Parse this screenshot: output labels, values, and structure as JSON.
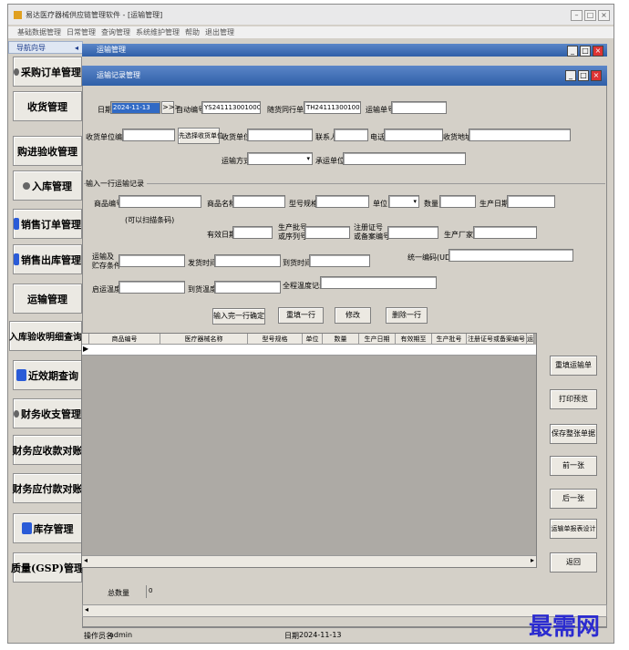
{
  "window": {
    "title": "易达医疗器械供应链管理软件 - [运输管理]"
  },
  "menu": [
    "基础数据管理",
    "日常管理",
    "查询管理",
    "系统维护管理",
    "帮助",
    "退出管理"
  ],
  "nav": {
    "header": "导航向导",
    "items": [
      "采购订单管理",
      "收货管理",
      "购进验收管理",
      "入库管理",
      "销售订单管理",
      "销售出库管理",
      "运输管理",
      "入库验收明细查询",
      "近效期查询",
      "财务收支管理",
      "财务应收款对账",
      "财务应付款对账",
      "库存管理",
      "质量(GSP)管理"
    ]
  },
  "outer_tab": "运输管理",
  "inner_title": "运输记录管理",
  "form": {
    "date_label": "日期",
    "date_value": "2024-11-13",
    "date_btn": ">>>",
    "auto_label": "自动编号",
    "auto_value": "YS2411130010001",
    "seq_label": "随货同行单号",
    "seq_value": "TH2411130010001",
    "ship_label": "运输单号",
    "recv_code_label": "收货单位编号",
    "pick_btn": "先选择收货单位",
    "recv_unit_label": "收货单位",
    "contact_label": "联系人",
    "phone_label": "电话",
    "addr_label": "收货地址",
    "method_label": "运输方式",
    "carrier_label": "承运单位"
  },
  "section": {
    "title": "输入一行运输记录",
    "code_label": "商品编号",
    "code_hint": "(可以扫描条码)",
    "name_label": "商品名称",
    "model_label": "型号规格",
    "unit_label": "单位",
    "qty_label": "数量",
    "prod_date_label": "生产日期",
    "expiry_label": "有效日期",
    "batch_label": "生产批号\n或序列号",
    "reg_label": "注册证号\n或备案编号",
    "maker_label": "生产厂家",
    "cond_label": "运输及\n贮存条件",
    "depart_label": "发货时间",
    "arrive_label": "到货时间",
    "udi_label": "统一编码(UDI)",
    "start_temp_label": "启运温度",
    "arrive_temp_label": "到货温度",
    "full_temp_label": "全程温度记录"
  },
  "actions": [
    "输入完一行确定",
    "重填一行",
    "修改",
    "删除一行"
  ],
  "grid": {
    "headers": [
      "商品编号",
      "医疗器械名称",
      "型号规格",
      "单位",
      "数量",
      "生产日期",
      "有效期至",
      "生产批号",
      "注册证号或备案编号",
      "运"
    ]
  },
  "side": [
    "重填运输单",
    "打印预览",
    "保存整张单据",
    "前一张",
    "后一张",
    "运输单报表设计",
    "返回"
  ],
  "total": {
    "label": "总数量",
    "value": "0"
  },
  "status": {
    "operator_label": "操作员名",
    "operator": "admin",
    "date_label": "日期",
    "date": "2024-11-13"
  },
  "watermark": "最需网"
}
